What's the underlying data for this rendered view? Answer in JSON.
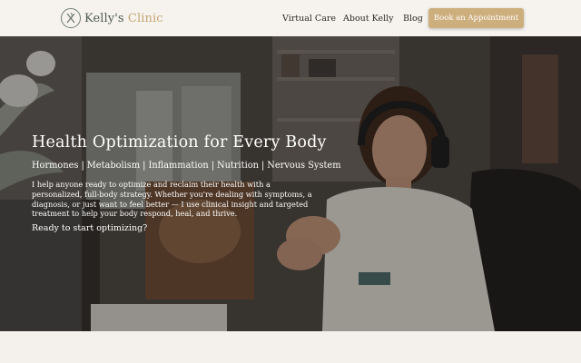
{
  "brand": {
    "name_primary": "Kelly's",
    "name_accent": "Clinic"
  },
  "nav": {
    "items": [
      {
        "label": "Virtual Care"
      },
      {
        "label": "About Kelly"
      },
      {
        "label": "Blog"
      }
    ],
    "cta_label": "Book an Appointment"
  },
  "hero": {
    "title": "Health Optimization for Every Body",
    "topics": [
      "Hormones",
      "Metabolism",
      "Inflammation",
      "Nutrition",
      "Nervous System"
    ],
    "body": "I help anyone ready to optimize and reclaim their health with a personalized, full-body strategy. Whether you're dealing with symptoms, a diagnosis, or just want to feel better — I use clinical insight and targeted treatment to help your body respond, heal, and thrive.",
    "cta_text": "Ready to start optimizing?"
  },
  "colors": {
    "accent": "#cdae7d",
    "header_bg": "#f6f3ee",
    "brand_text": "#4d5a4f"
  }
}
